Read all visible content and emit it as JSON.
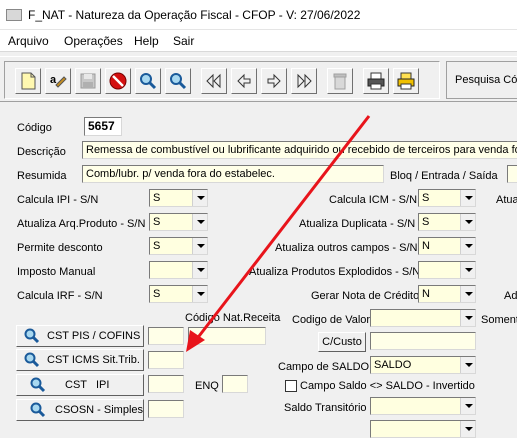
{
  "window": {
    "title": "F_NAT - Natureza da Operação Fiscal - CFOP - V: 27/06/2022"
  },
  "menu": [
    "Arquivo",
    "Operações",
    "Help",
    "Sair"
  ],
  "toolbar": {
    "buttons": [
      "new",
      "find-text",
      "save",
      "cancel",
      "search",
      "search-alt",
      "first",
      "previous",
      "next",
      "last",
      "delete",
      "print",
      "print-preview"
    ],
    "search_label": "Pesquisa Cód"
  },
  "form": {
    "codigo_label": "Código",
    "codigo_value": "5657",
    "descricao_label": "Descrição",
    "descricao_value": "Remessa de combustível ou lubrificante adquirido ou recebido de terceiros para venda fora",
    "resumida_label": "Resumida",
    "resumida_value": "Comb/lubr. p/ venda fora do estabelec.",
    "bloq_label": "Bloq / Entrada / Saída",
    "calcula_ipi_label": "Calcula IPI - S/N",
    "calcula_ipi_value": "S",
    "calcula_icm_label": "Calcula ICM - S/N",
    "calcula_icm_value": "S",
    "atua_trunc_label": "Atua",
    "atualiza_arq_label": "Atualiza Arq.Produto - S/N",
    "atualiza_arq_value": "S",
    "atualiza_dup_label": "Atualiza Duplicata - S/N",
    "atualiza_dup_value": "S",
    "permite_desc_label": "Permite desconto",
    "permite_desc_value": "S",
    "atualiza_outros_label": "Atualiza outros campos - S/N",
    "atualiza_outros_value": "N",
    "imposto_manual_label": "Imposto Manual",
    "imposto_manual_value": "",
    "atualiza_explod_label": "Atualiza Produtos Explodidos - S/N",
    "atualiza_explod_value": "",
    "calcula_irf_label": "Calcula IRF - S/N",
    "calcula_irf_value": "S",
    "gerar_nota_label": "Gerar Nota de Crédito",
    "gerar_nota_value": "N",
    "ad_trunc_label": "Ad",
    "cod_nat_receita_label": "Código Nat.Receita",
    "codigo_valor_label": "Codigo de Valor",
    "somente_trunc_label": "Somente",
    "cst_pis_btn": "CST PIS / COFINS",
    "cst_icms_btn": "CST ICMS Sit.Trib.",
    "cst_ipi_btn": "CST   IPI",
    "csosn_btn": "CSOSN - Simples",
    "enq_label": "ENQ",
    "ccusto_btn": "C/Custo",
    "campo_saldo_label": "Campo de SALDO",
    "campo_saldo_value": "SALDO",
    "campo_saldo_inv_label": "Campo Saldo <> SALDO - Invertido",
    "saldo_transitorio_label": "Saldo Transitório"
  },
  "annotation": {
    "arrow_color": "#e8141b"
  }
}
